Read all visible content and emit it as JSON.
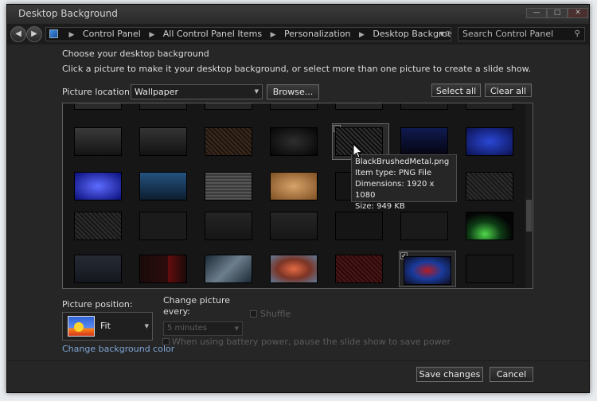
{
  "window": {
    "title": "Desktop Background",
    "controls": {
      "minimize": "—",
      "maximize": "□",
      "close": "✕"
    }
  },
  "nav": {
    "back_icon": "back-arrow-icon",
    "forward_icon": "forward-arrow-icon",
    "breadcrumb": [
      "Control Panel",
      "All Control Panel Items",
      "Personalization",
      "Desktop Background"
    ],
    "search_placeholder": "Search Control Panel"
  },
  "content": {
    "heading": "Choose your desktop background",
    "subheading": "Click a picture to make it your desktop background, or select more than one picture to create a slide show.",
    "location_label": "Picture location:",
    "location_value": "Wallpaper",
    "browse_label": "Browse...",
    "select_all_label": "Select all",
    "clear_all_label": "Clear all"
  },
  "tooltip": {
    "filename": "BlackBrushedMetal.png",
    "item_type": "Item type: PNG File",
    "dimensions": "Dimensions: 1920 x 1080",
    "size": "Size: 949 KB"
  },
  "position": {
    "label": "Picture position:",
    "value": "Fit"
  },
  "change": {
    "label": "Change picture every:",
    "interval": "5 minutes",
    "shuffle": "Shuffle",
    "battery": "When using battery power, pause the slide show to save power"
  },
  "links": {
    "background_color": "Change background color"
  },
  "footer": {
    "save_label": "Save changes",
    "cancel_label": "Cancel"
  },
  "colors": {
    "window_bg": "#262626",
    "link": "#7fa6d6"
  }
}
